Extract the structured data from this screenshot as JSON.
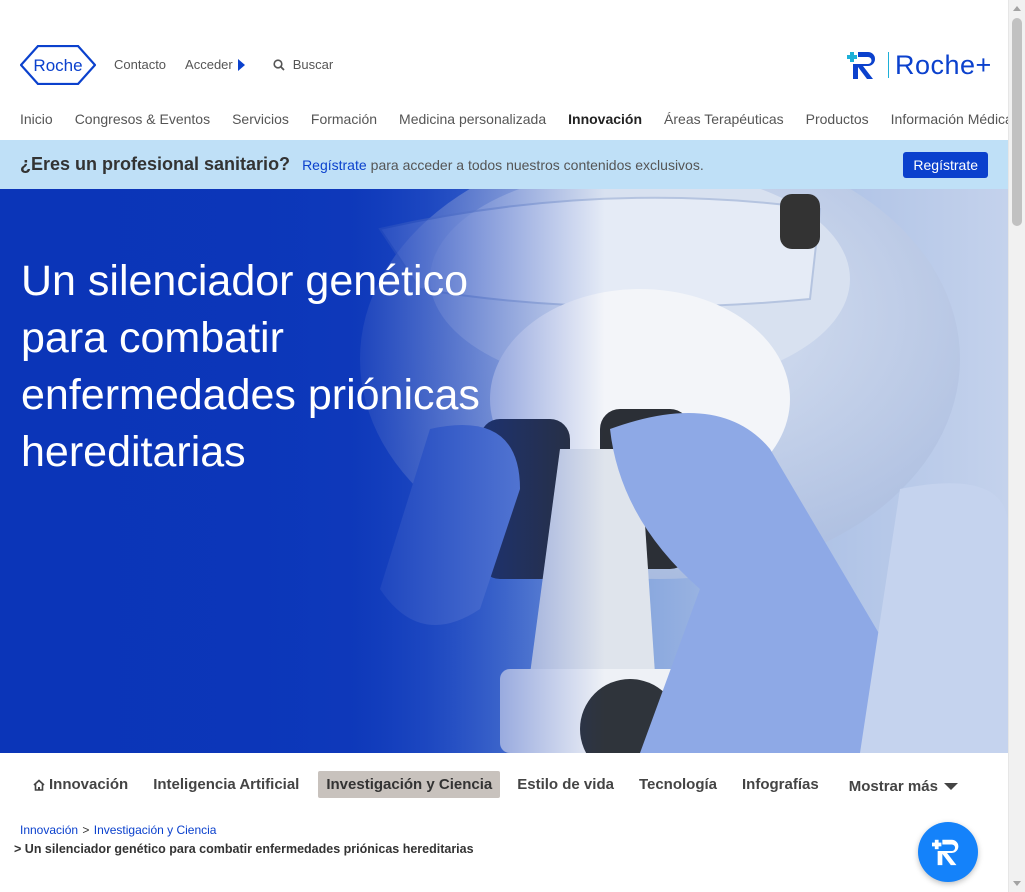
{
  "header": {
    "logo_text": "Roche",
    "contacto": "Contacto",
    "acceder": "Acceder",
    "search_placeholder": "Buscar",
    "roche_plus": "Roche+"
  },
  "nav": {
    "items": [
      {
        "label": "Inicio"
      },
      {
        "label": "Congresos & Eventos"
      },
      {
        "label": "Servicios"
      },
      {
        "label": "Formación"
      },
      {
        "label": "Medicina personalizada"
      },
      {
        "label": "Innovación"
      },
      {
        "label": "Áreas Terapéuticas"
      },
      {
        "label": "Productos"
      },
      {
        "label": "Información Médica"
      }
    ],
    "active": "Innovación"
  },
  "banner": {
    "question": "¿Eres un profesional sanitario?",
    "link": "Regístrate",
    "text": "para acceder a todos nuestros contenidos exclusivos.",
    "button": "Regístrate"
  },
  "hero": {
    "title": "Un silenciador genético para combatir enfermedades priónicas hereditarias"
  },
  "subnav": {
    "items": [
      {
        "label": "Innovación"
      },
      {
        "label": "Inteligencia Artificial"
      },
      {
        "label": "Investigación y Ciencia"
      },
      {
        "label": "Estilo de vida"
      },
      {
        "label": "Tecnología"
      },
      {
        "label": "Infografías"
      }
    ],
    "more": "Mostrar más",
    "active": "Investigación y Ciencia"
  },
  "breadcrumb": {
    "items": [
      {
        "label": "Innovación"
      },
      {
        "label": "Investigación y Ciencia"
      }
    ],
    "separator": ">",
    "current_prefix": ">",
    "current": "Un silenciador genético para combatir enfermedades priónicas hereditarias"
  },
  "colors": {
    "brand_blue": "#0b41cd",
    "banner_bg": "#bfe0f7",
    "fab_blue": "#1482fa",
    "roche_plus_cyan": "#1db0d8"
  }
}
